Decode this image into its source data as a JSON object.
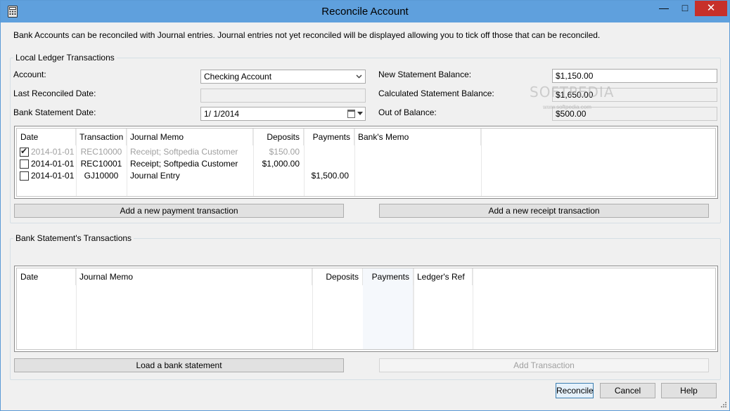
{
  "window": {
    "title": "Reconcile Account",
    "controls": {
      "minimize": "—",
      "maximize": "□",
      "close": "✕"
    }
  },
  "intro": "Bank Accounts can be reconciled with Journal entries. Journal entries not yet reconciled will be displayed allowing you to tick off those that can be reconciled.",
  "ledger": {
    "group_label": "Local Ledger Transactions",
    "account_label": "Account:",
    "account_value": "Checking Account",
    "last_reconciled_label": "Last Reconciled Date:",
    "last_reconciled_value": "",
    "statement_date_label": "Bank Statement Date:",
    "statement_date_value": "1/  1/2014",
    "new_balance_label": "New Statement Balance:",
    "new_balance_value": "$1,150.00",
    "calc_balance_label": "Calculated Statement Balance:",
    "calc_balance_value": "$1,650.00",
    "out_balance_label": "Out of Balance:",
    "out_balance_value": "$500.00",
    "columns": [
      "Date",
      "Transaction",
      "Journal Memo",
      "Deposits",
      "Payments",
      "Bank's Memo"
    ],
    "rows": [
      {
        "checked": true,
        "dim": true,
        "date": "2014-01-01",
        "transaction": "REC10000",
        "memo": "Receipt; Softpedia Customer",
        "deposits": "$150.00",
        "payments": "",
        "bank_memo": ""
      },
      {
        "checked": false,
        "dim": false,
        "date": "2014-01-01",
        "transaction": "REC10001",
        "memo": "Receipt; Softpedia Customer",
        "deposits": "$1,000.00",
        "payments": "",
        "bank_memo": ""
      },
      {
        "checked": false,
        "dim": false,
        "date": "2014-01-01",
        "transaction": "GJ10000",
        "memo": "Journal Entry",
        "deposits": "",
        "payments": "$1,500.00",
        "bank_memo": ""
      }
    ],
    "add_payment_label": "Add a new payment transaction",
    "add_receipt_label": "Add a new receipt transaction"
  },
  "bank": {
    "group_label": "Bank Statement's Transactions",
    "columns": [
      "Date",
      "Journal Memo",
      "Deposits",
      "Payments",
      "Ledger's Ref"
    ],
    "load_label": "Load a bank statement",
    "add_transaction_label": "Add Transaction"
  },
  "buttons": {
    "reconcile": "Reconcile",
    "cancel": "Cancel",
    "help": "Help"
  },
  "watermark": {
    "text": "SOFTPEDIA",
    "sub": "www.softpedia.com"
  }
}
